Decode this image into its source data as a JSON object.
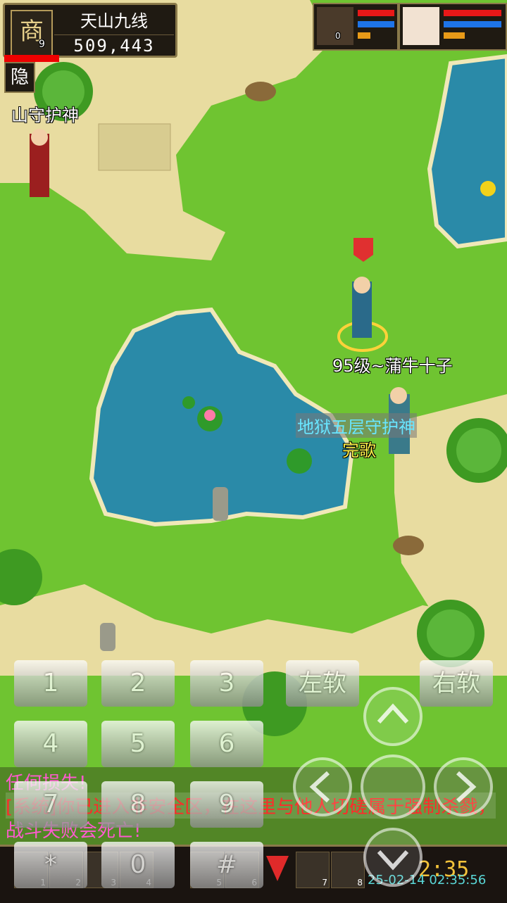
{
  "hud": {
    "avatar_glyph": "商",
    "level": "9",
    "player_name": "天山九线",
    "gold": "509,443",
    "hide_label": "隐"
  },
  "party": [
    {
      "hp_color": "#e81818",
      "mp_color": "#1e74e8",
      "level": "0"
    },
    {
      "hp_color": "#e81818",
      "mp_color": "#1e74e8"
    }
  ],
  "npcs": {
    "mountain_guardian": "山守护神",
    "player_tag": "95级~蒲牛十子",
    "hell_guardian": "地狱五层守护神",
    "hell_guardian_sub": "完歌"
  },
  "keypad": {
    "k1": "1",
    "k2": "2",
    "k3": "3",
    "k4": "4",
    "k5": "5",
    "k6": "6",
    "k7": "7",
    "k8": "8",
    "k9": "9",
    "star": "*",
    "k0": "0",
    "hash": "#",
    "left_soft": "左软",
    "right_soft": "右软"
  },
  "chat": {
    "line1": "任何损失!",
    "line2": "[系统]你已进入非安全区，在这里与他人切磋属于强制杀戮，",
    "line3": "战斗失败会死亡!"
  },
  "status": {
    "clock": "2:35",
    "datetime": "25-02-14 02:35:56"
  },
  "slots": [
    "1",
    "2",
    "3",
    "4",
    "5",
    "6",
    "7",
    "8"
  ],
  "colors": {
    "grass": "#6fc431",
    "water": "#2a8aa8",
    "sand": "#e8dca0",
    "chat_pink": "#ff5ad0",
    "chat_red": "#ff2a2a",
    "name_cyan": "#69e6ff",
    "name_yellow": "#fff24a"
  }
}
